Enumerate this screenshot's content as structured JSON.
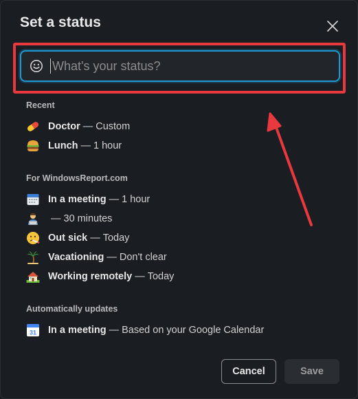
{
  "dialog": {
    "title": "Set a status",
    "close_icon": "close-icon"
  },
  "input": {
    "placeholder": "What's your status?",
    "value": "",
    "emoji_icon": "smiley-icon"
  },
  "sections": [
    {
      "header": "Recent",
      "items": [
        {
          "icon": "pill-icon",
          "name": "Doctor",
          "detail": "Custom"
        },
        {
          "icon": "hamburger-icon",
          "name": "Lunch",
          "detail": "1 hour"
        }
      ]
    },
    {
      "header": "For WindowsReport.com",
      "items": [
        {
          "icon": "calendar-icon",
          "name": "In a meeting",
          "detail": "1 hour"
        },
        {
          "icon": "commuting-icon",
          "name": "",
          "detail": "30 minutes"
        },
        {
          "icon": "thermometer-face-icon",
          "name": "Out sick",
          "detail": "Today"
        },
        {
          "icon": "palm-tree-icon",
          "name": "Vacationing",
          "detail": "Don't clear"
        },
        {
          "icon": "house-icon",
          "name": "Working remotely",
          "detail": "Today"
        }
      ]
    },
    {
      "header": "Automatically updates",
      "items": [
        {
          "icon": "google-calendar-icon",
          "name": "In a meeting",
          "detail": "Based on your Google Calendar",
          "badge": "31"
        }
      ]
    }
  ],
  "separator": "—",
  "buttons": {
    "cancel_label": "Cancel",
    "save_label": "Save"
  },
  "colors": {
    "background": "#1a1d21",
    "focus_ring": "#1d9bd1",
    "annotation_red": "#e8393f"
  }
}
